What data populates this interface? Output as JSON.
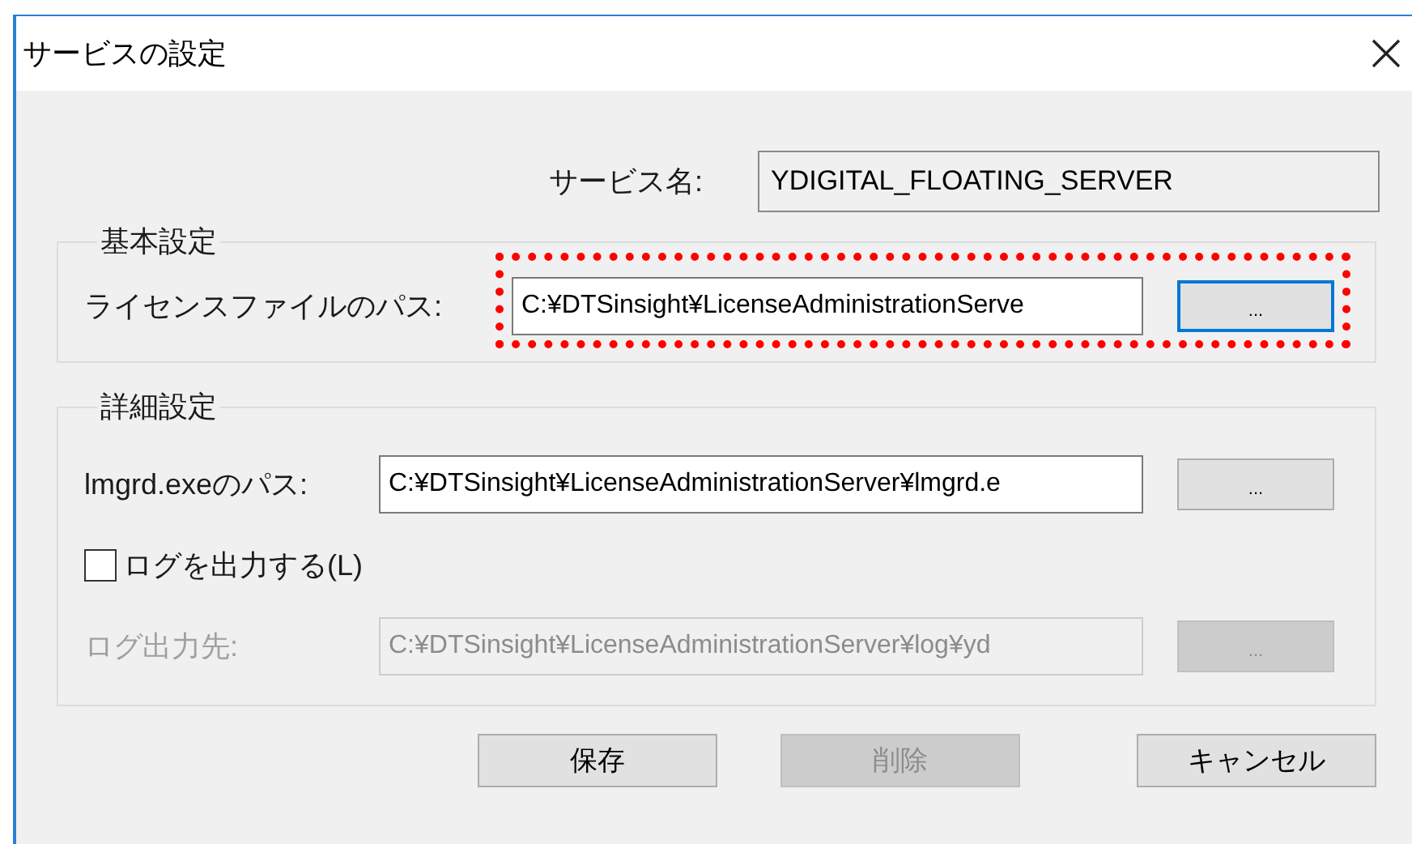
{
  "window": {
    "title": "サービスの設定"
  },
  "service_name": {
    "label": "サービス名:",
    "value": "YDIGITAL_FLOATING_SERVER"
  },
  "basic_settings": {
    "title": "基本設定",
    "rows": [
      {
        "label": "ライセンスファイルのパス:",
        "value": "C:¥DTSinsight¥LicenseAdministrationServe",
        "button": "...",
        "disabled": false,
        "focused": true,
        "highlighted": true
      }
    ]
  },
  "advanced_settings": {
    "title": "詳細設定",
    "items": [
      {
        "kind": "path",
        "label": "lmgrd.exeのパス:",
        "value": "C:¥DTSinsight¥LicenseAdministrationServer¥lmgrd.e",
        "button": "...",
        "disabled": false,
        "focused": false,
        "highlighted": false
      },
      {
        "kind": "checkbox",
        "label": "ログを出力する(L)",
        "checked": false
      },
      {
        "kind": "path",
        "label": "ログ出力先:",
        "value": "C:¥DTSinsight¥LicenseAdministrationServer¥log¥yd",
        "button": "...",
        "disabled": true,
        "focused": false,
        "highlighted": false
      }
    ]
  },
  "buttons": [
    {
      "label": "保存",
      "disabled": false
    },
    {
      "label": "削除",
      "disabled": true
    },
    {
      "label": "キャンセル",
      "disabled": false
    }
  ]
}
